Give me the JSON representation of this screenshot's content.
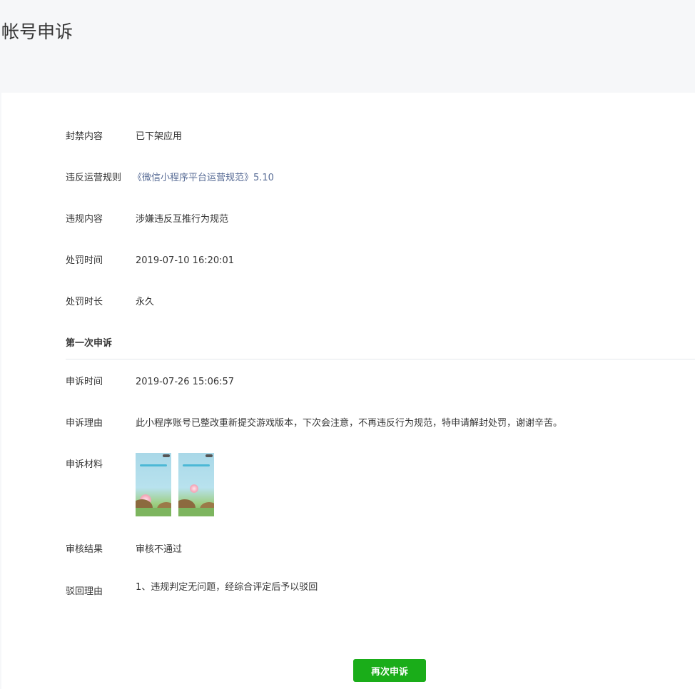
{
  "page": {
    "title": "帐号申诉"
  },
  "details": {
    "ban_content": {
      "label": "封禁内容",
      "value": "已下架应用"
    },
    "violated_rule": {
      "label": "违反运营规则",
      "value": "《微信小程序平台运营规范》5.10"
    },
    "violation": {
      "label": "违规内容",
      "value": "涉嫌违反互推行为规范"
    },
    "penalty_time": {
      "label": "处罚时间",
      "value": "2019-07-10 16:20:01"
    },
    "penalty_duration": {
      "label": "处罚时长",
      "value": "永久"
    }
  },
  "appeal": {
    "section_title": "第一次申诉",
    "appeal_time": {
      "label": "申诉时间",
      "value": "2019-07-26 15:06:57"
    },
    "appeal_reason": {
      "label": "申诉理由",
      "value": "此小程序账号已整改重新提交游戏版本，下次会注意，不再违反行为规范，特申请解封处罚，谢谢辛苦。"
    },
    "materials": {
      "label": "申诉材料"
    },
    "review_result": {
      "label": "审核结果",
      "value": "审核不通过"
    },
    "rejection_reason": {
      "label": "驳回理由",
      "value": "1、违规判定无问题，经综合评定后予以驳回"
    }
  },
  "actions": {
    "resubmit_label": "再次申诉"
  },
  "colors": {
    "link": "#576b95",
    "primary_button": "#1aad19",
    "header_bg": "#f6f7f9"
  }
}
